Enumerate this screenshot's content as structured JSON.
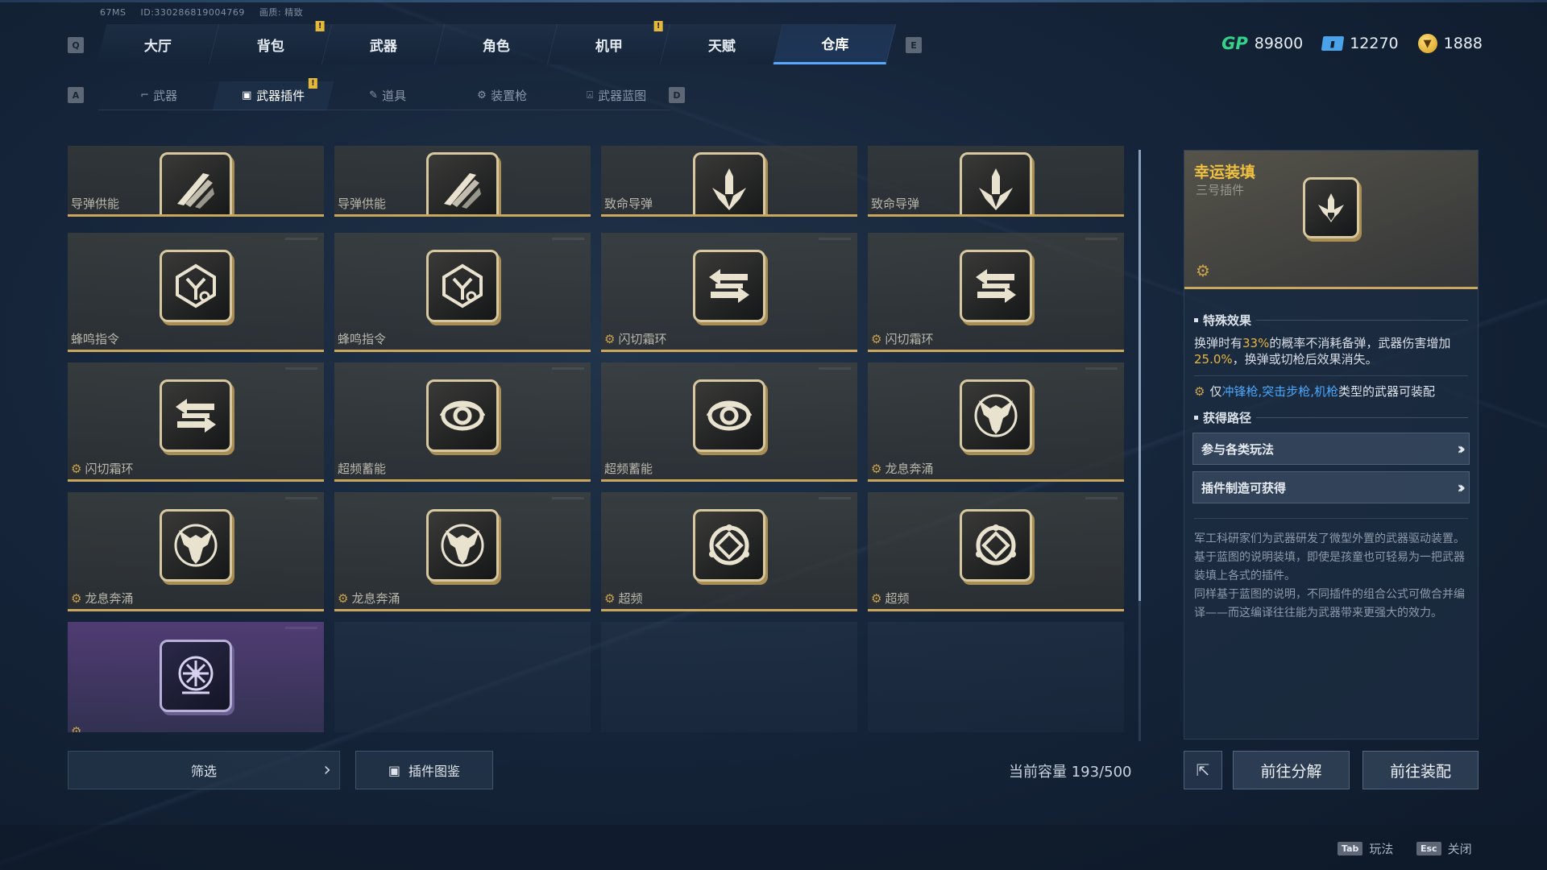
{
  "top_info": {
    "fps": "67MS",
    "id": "ID:330286819004769",
    "quality": "画质: 精致"
  },
  "keys": {
    "prev_main": "Q",
    "next_main": "E",
    "prev_sub": "A",
    "next_sub": "D"
  },
  "main_tabs": [
    {
      "label": "大厅",
      "alert": false,
      "active": false
    },
    {
      "label": "背包",
      "alert": true,
      "active": false
    },
    {
      "label": "武器",
      "alert": false,
      "active": false
    },
    {
      "label": "角色",
      "alert": false,
      "active": false
    },
    {
      "label": "机甲",
      "alert": true,
      "active": false
    },
    {
      "label": "天赋",
      "alert": false,
      "active": false
    },
    {
      "label": "仓库",
      "alert": false,
      "active": true
    }
  ],
  "alert_mark": "!",
  "currencies": {
    "gp_label": "GP",
    "gp": "89800",
    "ticket": "12270",
    "coin": "1888"
  },
  "sub_tabs": [
    {
      "label": "武器",
      "icon": "gun-icon",
      "active": false
    },
    {
      "label": "武器插件",
      "icon": "plugin-icon",
      "active": true,
      "alert": true
    },
    {
      "label": "道具",
      "icon": "item-icon",
      "active": false
    },
    {
      "label": "装置枪",
      "icon": "device-gun-icon",
      "active": false
    },
    {
      "label": "武器蓝图",
      "icon": "blueprint-icon",
      "active": false
    }
  ],
  "grid": [
    {
      "name": "导弹供能",
      "icon": "missile-energy",
      "equippable": false
    },
    {
      "name": "导弹供能",
      "icon": "missile-energy",
      "equippable": false
    },
    {
      "name": "致命导弹",
      "icon": "lethal-missile",
      "equippable": false
    },
    {
      "name": "致命导弹",
      "icon": "lethal-missile",
      "equippable": false
    },
    {
      "name": "蜂鸣指令",
      "icon": "buzz-command",
      "equippable": false
    },
    {
      "name": "蜂鸣指令",
      "icon": "buzz-command",
      "equippable": false
    },
    {
      "name": "闪切霜环",
      "icon": "flash-swap",
      "equippable": true
    },
    {
      "name": "闪切霜环",
      "icon": "flash-swap",
      "equippable": true
    },
    {
      "name": "闪切霜环",
      "icon": "flash-swap",
      "equippable": true
    },
    {
      "name": "超频蓄能",
      "icon": "overclock-charge",
      "equippable": false
    },
    {
      "name": "超频蓄能",
      "icon": "overclock-charge",
      "equippable": false
    },
    {
      "name": "龙息奔涌",
      "icon": "dragon-breath",
      "equippable": true
    },
    {
      "name": "龙息奔涌",
      "icon": "dragon-breath",
      "equippable": true
    },
    {
      "name": "龙息奔涌",
      "icon": "dragon-breath",
      "equippable": true
    },
    {
      "name": "超频",
      "icon": "overclock",
      "equippable": true
    },
    {
      "name": "超频",
      "icon": "overclock",
      "equippable": true
    },
    {
      "name": "",
      "icon": "purple-flower",
      "equippable": true,
      "purple": true
    },
    {
      "name": "",
      "empty": true
    },
    {
      "name": "",
      "empty": true
    },
    {
      "name": "",
      "empty": true
    }
  ],
  "bottom": {
    "filter_label": "筛选",
    "codex_label": "插件图鉴",
    "capacity": "当前容量 193/500"
  },
  "detail": {
    "title": "幸运装填",
    "subtitle": "三号插件",
    "icon": "lucky-reload-icon",
    "effect_header": "特殊效果",
    "effect_pre": "换弹时有",
    "effect_pct1": "33%",
    "effect_mid": "的概率不消耗备弹，武器伤害增加",
    "effect_pct2": "25.0%",
    "effect_post": "，换弹或切枪后效果消失。",
    "restrict_pre": "仅",
    "restrict_types": "冲锋枪,突击步枪,机枪",
    "restrict_post": "类型的武器可装配",
    "route_header": "获得路径",
    "routes": [
      "参与各类玩法",
      "插件制造可获得"
    ],
    "lore": "军工科研家们为武器研发了微型外置的武器驱动装置。\n基于蓝图的说明装填，即使是孩童也可轻易为一把武器装填上各式的插件。\n同样基于蓝图的说明，不同插件的组合公式可做合并编译——而这编译往往能为武器带来更强大的效力。"
  },
  "actions": {
    "dismantle": "前往分解",
    "equip": "前往装配"
  },
  "footer": {
    "tab_key": "Tab",
    "tab_label": "玩法",
    "esc_key": "Esc",
    "esc_label": "关闭"
  },
  "colors": {
    "accent_gold": "#caa75c",
    "title_gold": "#f0c040",
    "highlight_blue": "#4aa8ff",
    "active_tab": "#5aa9ff"
  }
}
